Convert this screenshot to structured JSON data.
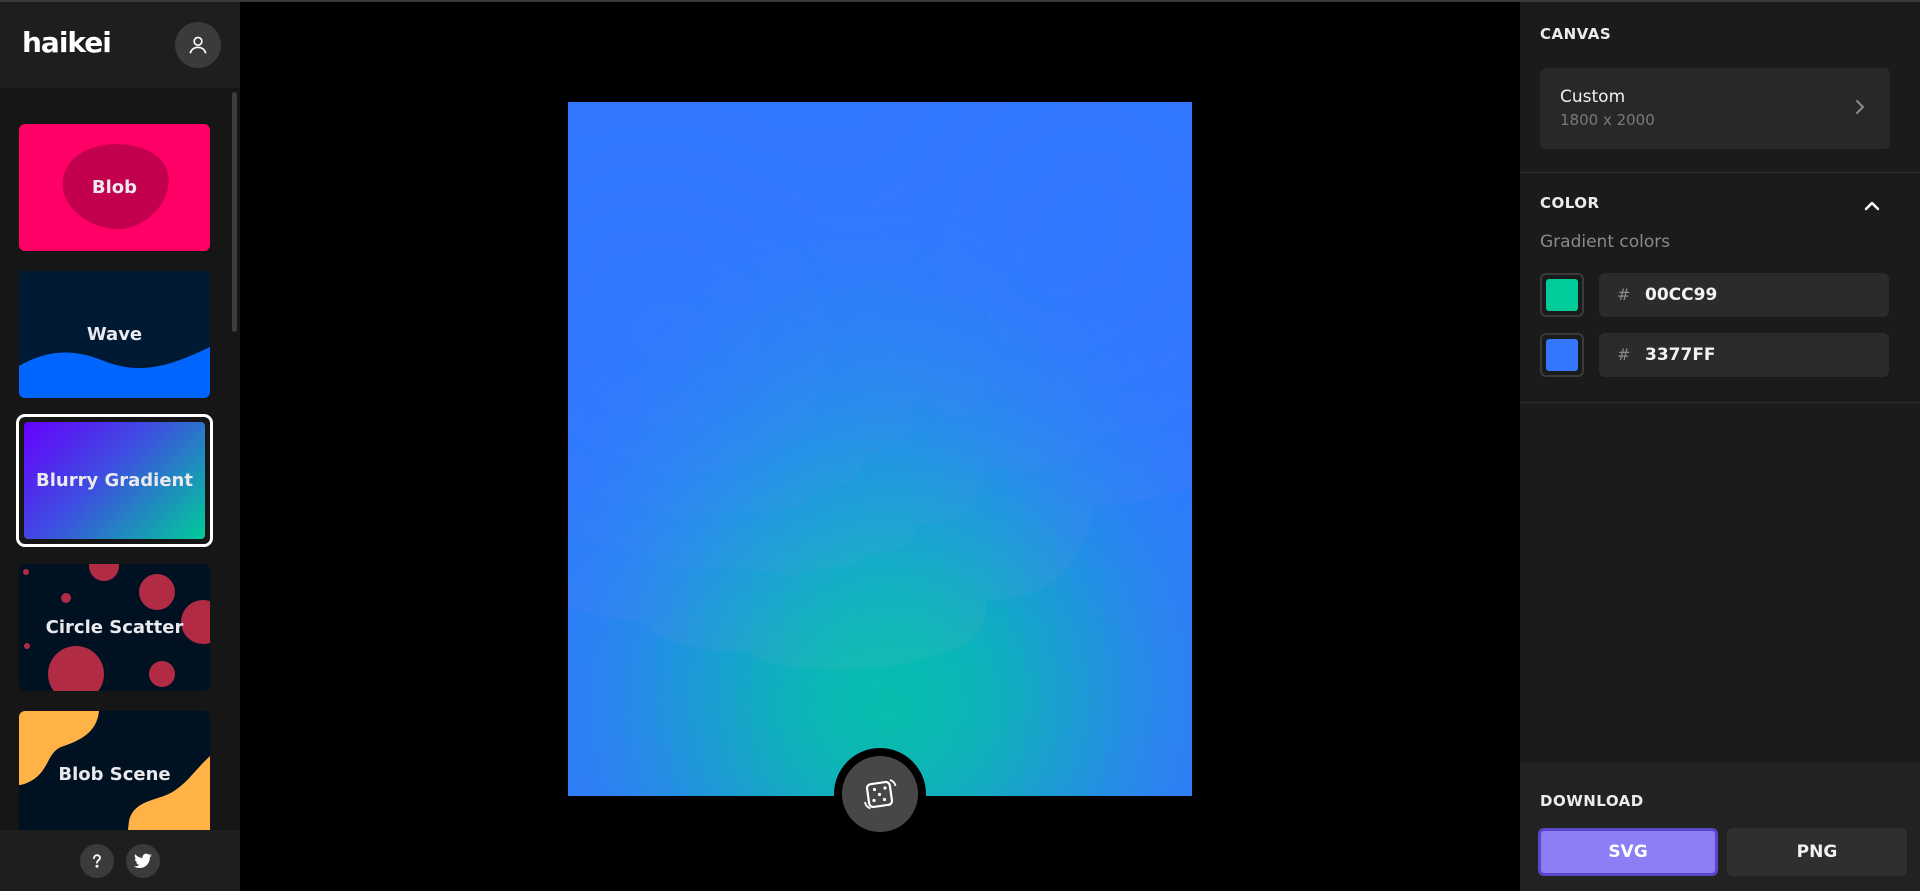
{
  "app": {
    "logo": "haikei"
  },
  "sidebar": {
    "generators": [
      {
        "label": "Blob",
        "bg": "#FF0066",
        "accent": "#C2004E"
      },
      {
        "label": "Wave",
        "bg": "#001A33",
        "accent": "#0066FF"
      },
      {
        "label": "Blurry Gradient",
        "bg": "#6600FF",
        "accent": "#00CC99",
        "selected": true
      },
      {
        "label": "Circle Scatter",
        "bg": "#001122",
        "accent": "#B22B45"
      },
      {
        "label": "Blob Scene",
        "bg": "#001122",
        "accent": "#FFB347"
      }
    ],
    "footer": {
      "help_icon": "question-icon",
      "social_icon": "twitter-icon"
    }
  },
  "canvas": {
    "gradient_colors": [
      "#00CC99",
      "#3377FF"
    ]
  },
  "panel": {
    "canvas_section": {
      "title": "CANVAS",
      "size_name": "Custom",
      "size_dims": "1800 x 2000"
    },
    "color_section": {
      "title": "COLOR",
      "sub_label": "Gradient colors",
      "hash": "#",
      "colors": [
        {
          "hex": "00CC99",
          "swatch": "#00CC99"
        },
        {
          "hex": "3377FF",
          "swatch": "#3377FF"
        }
      ]
    },
    "download_section": {
      "title": "DOWNLOAD",
      "svg_label": "SVG",
      "png_label": "PNG"
    }
  }
}
